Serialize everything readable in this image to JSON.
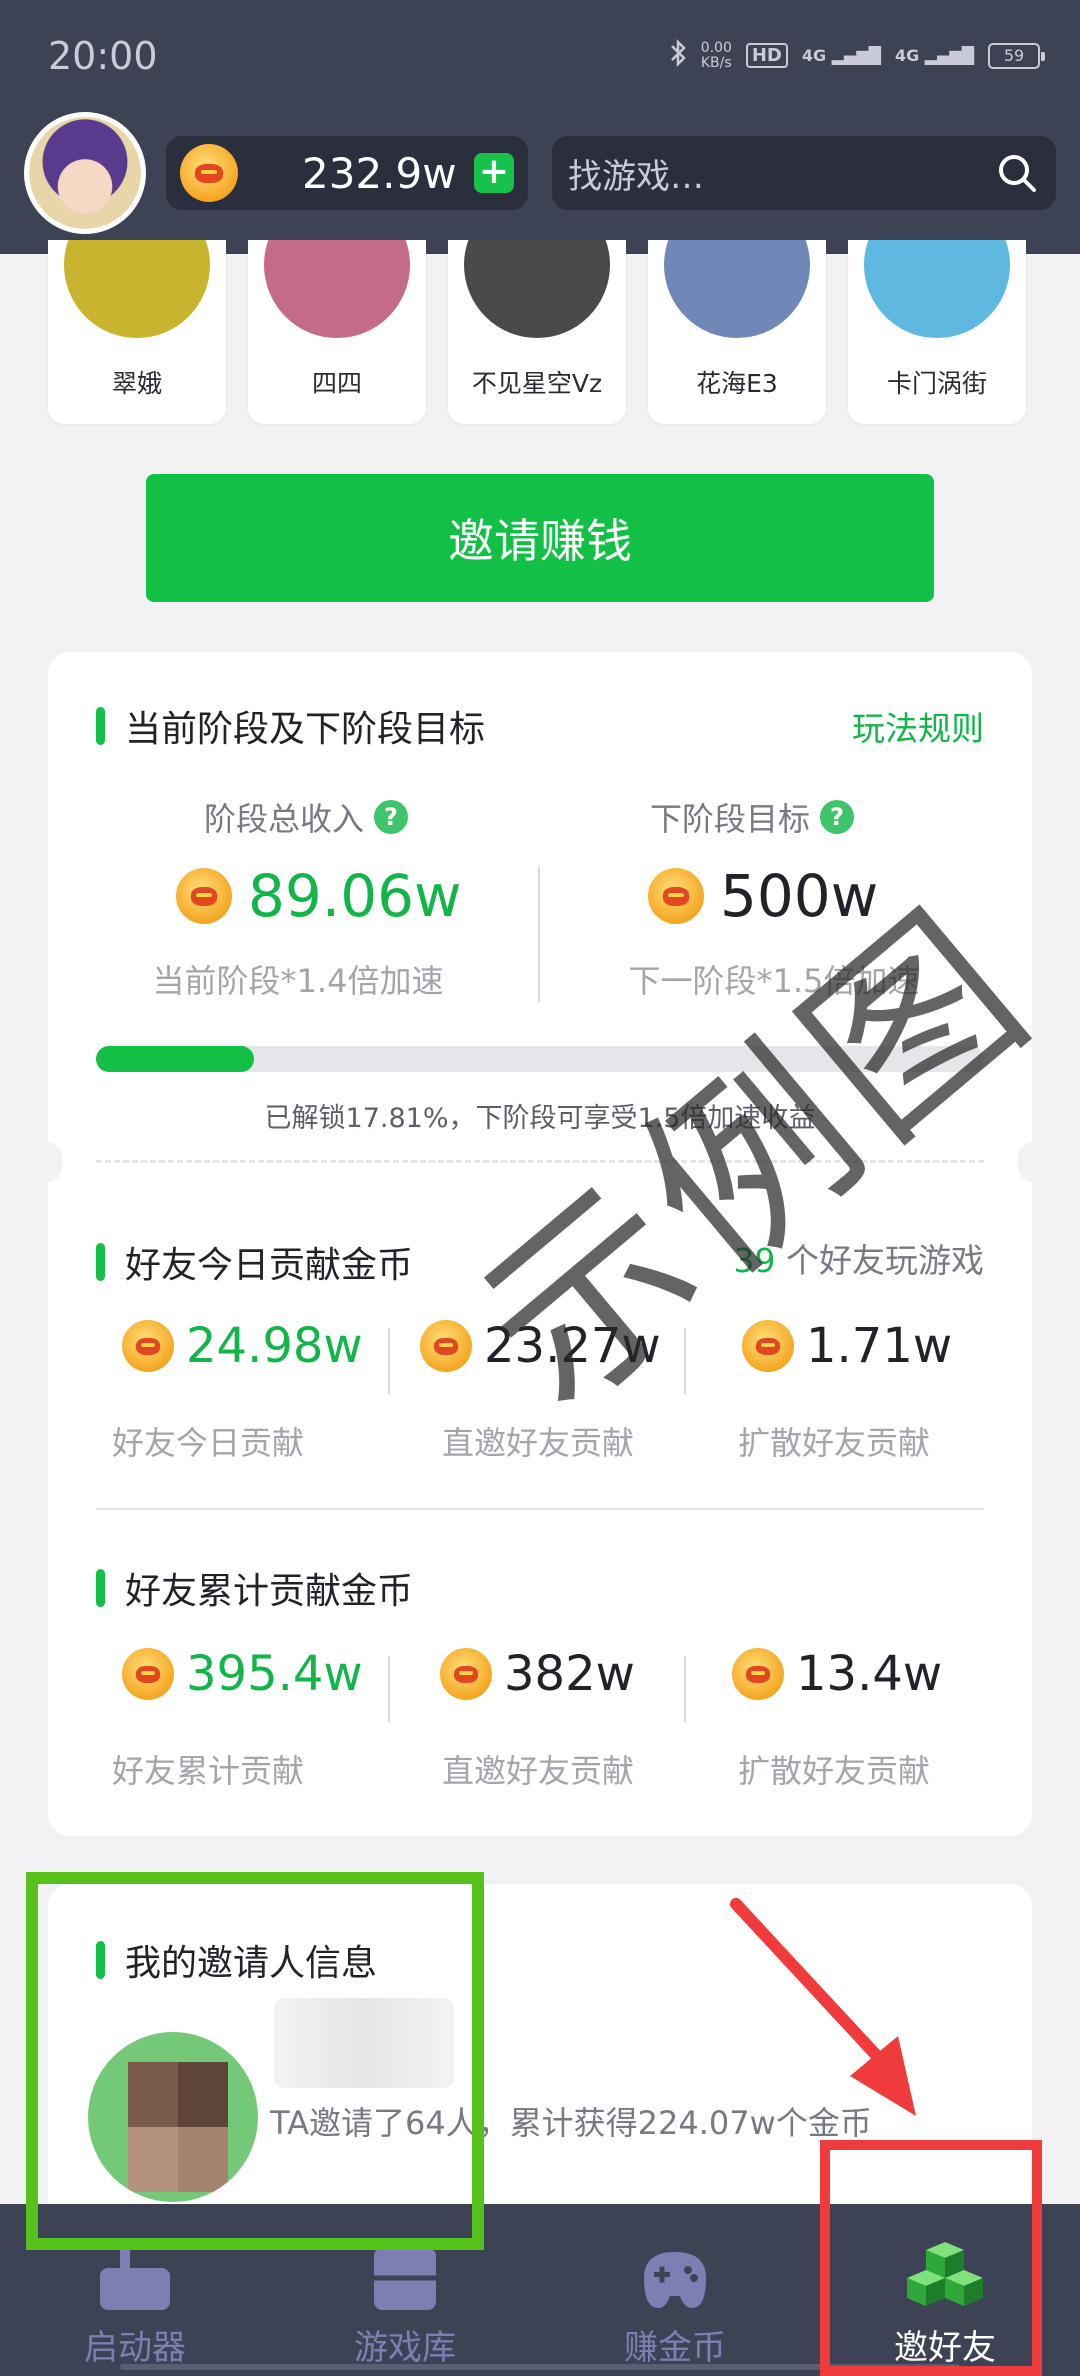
{
  "status_bar": {
    "time": "20:00",
    "net_speed": "0.00",
    "net_unit": "KB/s",
    "hd": "HD",
    "signal_1": "4G",
    "signal_2": "4G",
    "battery": "59",
    "icons": [
      "bluetooth-icon",
      "signal-icon",
      "battery-icon"
    ]
  },
  "header": {
    "coin_balance": "232.9w",
    "plus_label": "+",
    "search_placeholder": "找游戏…"
  },
  "friends_row": [
    {
      "name": "翠娥",
      "color": "#c9b430"
    },
    {
      "name": "四四",
      "color": "#c46a8a"
    },
    {
      "name": "不见星空Vz",
      "color": "#4a4a4a"
    },
    {
      "name": "花海E3",
      "color": "#6f88b8"
    },
    {
      "name": "卡门涡街",
      "color": "#5fb8e0"
    }
  ],
  "invite_button": "邀请赚钱",
  "stage": {
    "title": "当前阶段及下阶段目标",
    "rules_link": "玩法规则",
    "total_income_label": "阶段总收入",
    "total_income_value": "89.06w",
    "current_boost": "当前阶段*1.4倍加速",
    "next_target_label": "下阶段目标",
    "next_target_value": "500w",
    "next_boost": "下一阶段*1.5倍加速",
    "progress_percent": 17.81,
    "progress_note": "已解锁17.81%，下阶段可享受1.5倍加速收益"
  },
  "today": {
    "title": "好友今日贡献金币",
    "friends_count": "39",
    "friends_suffix": "个好友玩游戏",
    "stats": [
      {
        "value": "24.98w",
        "label": "好友今日贡献"
      },
      {
        "value": "23.27w",
        "label": "直邀好友贡献"
      },
      {
        "value": "1.71w",
        "label": "扩散好友贡献"
      }
    ]
  },
  "total": {
    "title": "好友累计贡献金币",
    "stats": [
      {
        "value": "395.4w",
        "label": "好友累计贡献"
      },
      {
        "value": "382w",
        "label": "直邀好友贡献"
      },
      {
        "value": "13.4w",
        "label": "扩散好友贡献"
      }
    ]
  },
  "inviter": {
    "title": "我的邀请人信息",
    "stats_text": "TA邀请了64人，累计获得224.07w个金币"
  },
  "watermark": "示例图",
  "bottom_nav": [
    {
      "label": "启动器",
      "icon": "launcher-icon"
    },
    {
      "label": "游戏库",
      "icon": "game-library-icon"
    },
    {
      "label": "赚金币",
      "icon": "gamepad-icon"
    },
    {
      "label": "邀好友",
      "icon": "invite-friends-icon"
    }
  ],
  "colors": {
    "header_bg": "#3d4255",
    "accent_green": "#12c045",
    "annotation_green": "#56c11a",
    "annotation_red": "#ef3b3b"
  }
}
